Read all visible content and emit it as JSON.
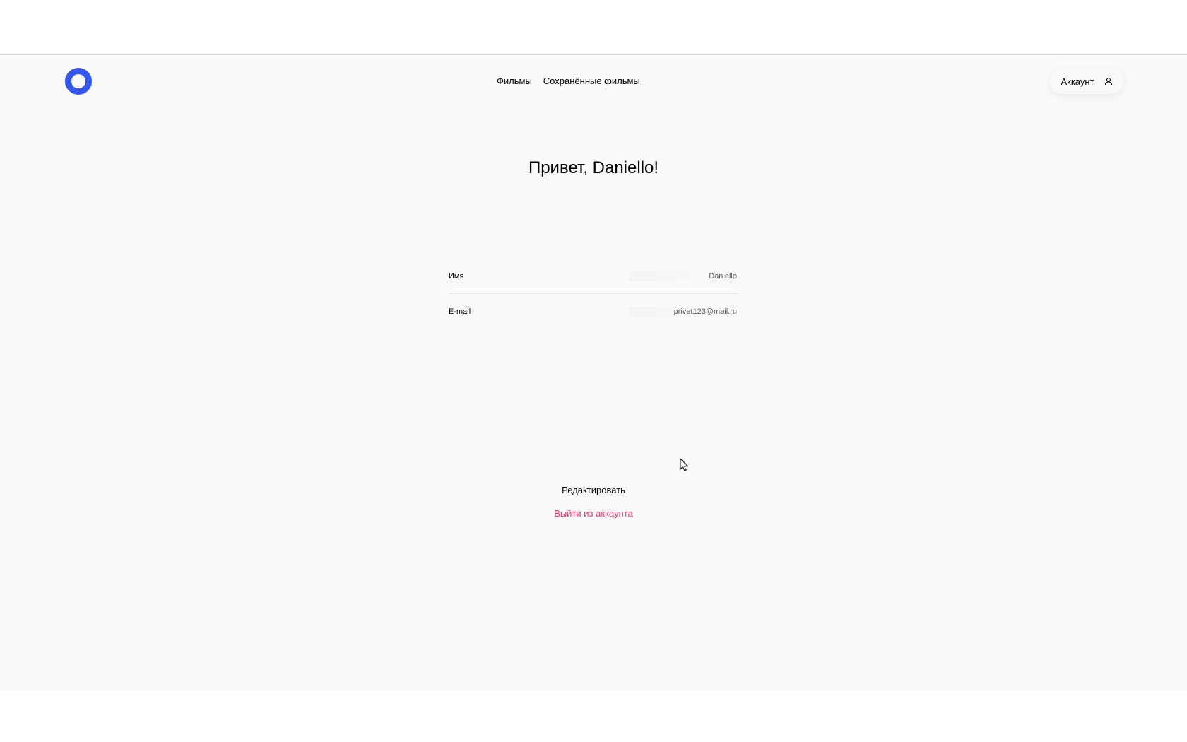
{
  "header": {
    "logo_icon": "ring-logo-icon",
    "logo_color": "#3456f3",
    "nav": [
      {
        "label": "Фильмы"
      },
      {
        "label": "Сохранённые фильмы"
      }
    ],
    "account_label": "Аккаунт",
    "account_icon": "user-icon"
  },
  "profile": {
    "greeting": "Привет, Daniello!",
    "fields": [
      {
        "label": "Имя",
        "value": "Daniello"
      },
      {
        "label": "E-mail",
        "value": "privet123@mail.ru"
      }
    ]
  },
  "actions": {
    "edit_label": "Редактировать",
    "logout_label": "Выйти из аккаунта",
    "logout_color": "#ee3465"
  }
}
